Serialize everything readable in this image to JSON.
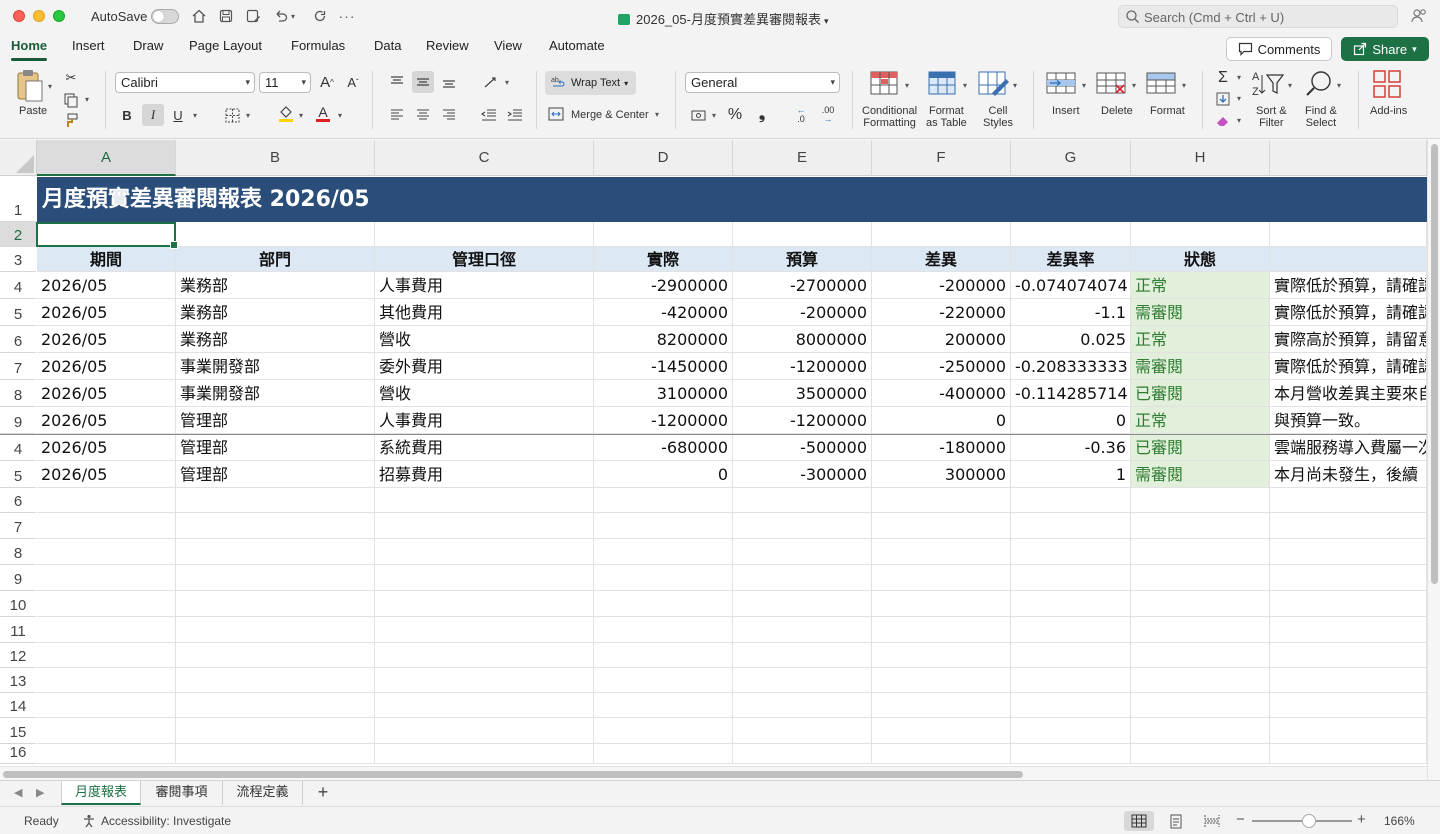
{
  "titlebar": {
    "autosave_label": "AutoSave",
    "doc_title": "2026_05-月度預實差異審閱報表",
    "search_placeholder": "Search (Cmd + Ctrl + U)"
  },
  "menu_tabs": [
    "Home",
    "Insert",
    "Draw",
    "Page Layout",
    "Formulas",
    "Data",
    "Review",
    "View",
    "Automate"
  ],
  "active_menu_tab": "Home",
  "header_buttons": {
    "comments": "Comments",
    "share": "Share"
  },
  "ribbon": {
    "paste": "Paste",
    "font_name": "Calibri",
    "font_size": "11",
    "bold": "B",
    "italic": "I",
    "underline": "U",
    "wrap_text": "Wrap Text",
    "merge_center": "Merge & Center",
    "number_format": "General",
    "percent": "%",
    "comma": "❟",
    "dec_inc": ".00",
    "dec_dec": ".0",
    "conditional_formatting": [
      "Conditional",
      "Formatting"
    ],
    "format_as_table": [
      "Format",
      "as Table"
    ],
    "cell_styles": [
      "Cell",
      "Styles"
    ],
    "insert": "Insert",
    "delete": "Delete",
    "format": "Format",
    "sort_filter": [
      "Sort &",
      "Filter"
    ],
    "find_select": [
      "Find &",
      "Select"
    ],
    "addins": "Add-ins",
    "colors": {
      "fill_highlight": "#ffd400",
      "font_color": "#e02020"
    }
  },
  "sheet": {
    "columns": [
      "A",
      "B",
      "C",
      "D",
      "E",
      "F",
      "G",
      "H"
    ],
    "row_numbers": [
      "1",
      "2",
      "3",
      "4",
      "5",
      "6",
      "7",
      "8",
      "9",
      "4",
      "5",
      "6",
      "7",
      "8",
      "9",
      "10",
      "11",
      "12",
      "13",
      "14",
      "15",
      "16"
    ],
    "title": "月度預實差異審閱報表 2026/05",
    "headers": [
      "期間",
      "部門",
      "管理口徑",
      "實際",
      "預算",
      "差異",
      "差異率",
      "狀態"
    ],
    "rows": [
      [
        "2026/05",
        "業務部",
        "人事費用",
        "-2900000",
        "-2700000",
        "-200000",
        "-0.074074074",
        "正常",
        "實際低於預算，請確認"
      ],
      [
        "2026/05",
        "業務部",
        "其他費用",
        "-420000",
        "-200000",
        "-220000",
        "-1.1",
        "需審閱",
        "實際低於預算，請確認"
      ],
      [
        "2026/05",
        "業務部",
        "營收",
        "8200000",
        "8000000",
        "200000",
        "0.025",
        "正常",
        "實際高於預算，請留意"
      ],
      [
        "2026/05",
        "事業開發部",
        "委外費用",
        "-1450000",
        "-1200000",
        "-250000",
        "-0.208333333",
        "需審閱",
        "實際低於預算，請確認"
      ],
      [
        "2026/05",
        "事業開發部",
        "營收",
        "3100000",
        "3500000",
        "-400000",
        "-0.114285714",
        "已審閱",
        "本月營收差異主要來自"
      ],
      [
        "2026/05",
        "管理部",
        "人事費用",
        "-1200000",
        "-1200000",
        "0",
        "0",
        "正常",
        "與預算一致。"
      ],
      [
        "2026/05",
        "管理部",
        "系統費用",
        "-680000",
        "-500000",
        "-180000",
        "-0.36",
        "已審閱",
        "雲端服務導入費屬一次"
      ],
      [
        "2026/05",
        "管理部",
        "招募費用",
        "0",
        "-300000",
        "300000",
        "1",
        "需審閱",
        "本月尚未發生，後續"
      ]
    ],
    "status_color": "#2e7d32",
    "title_bg": "#2a4d7a",
    "header_bg": "#dde8f5"
  },
  "sheet_tabs": [
    "月度報表",
    "審閱事項",
    "流程定義"
  ],
  "active_sheet": "月度報表",
  "statusbar": {
    "ready": "Ready",
    "accessibility": "Accessibility: Investigate",
    "zoom": "166%"
  }
}
